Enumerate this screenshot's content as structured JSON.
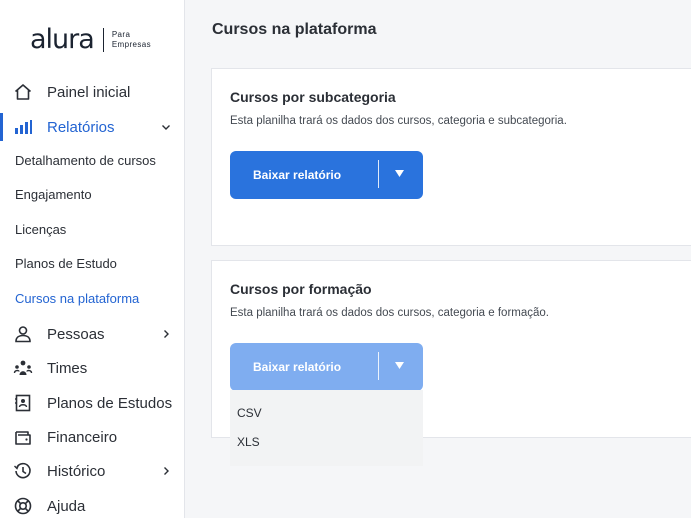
{
  "brand": {
    "name": "alura",
    "tagline_line1": "Para",
    "tagline_line2": "Empresas"
  },
  "sidebar": {
    "main_items": [
      {
        "label": "Painel inicial",
        "icon": "home-icon"
      },
      {
        "label": "Relatórios",
        "icon": "bar-chart-icon",
        "expanded": true,
        "active": true
      },
      {
        "label": "Pessoas",
        "icon": "person-icon",
        "has_submenu": true
      },
      {
        "label": "Times",
        "icon": "team-icon"
      },
      {
        "label": "Planos de Estudos",
        "icon": "study-plan-icon"
      },
      {
        "label": "Financeiro",
        "icon": "wallet-icon"
      },
      {
        "label": "Histórico",
        "icon": "history-icon",
        "has_submenu": true
      },
      {
        "label": "Ajuda",
        "icon": "help-icon"
      }
    ],
    "report_subitems": [
      {
        "label": "Detalhamento de cursos"
      },
      {
        "label": "Engajamento"
      },
      {
        "label": "Licenças"
      },
      {
        "label": "Planos de Estudo"
      },
      {
        "label": "Cursos na plataforma",
        "current": true
      }
    ]
  },
  "main": {
    "title": "Cursos na plataforma",
    "cards": [
      {
        "title": "Cursos por subcategoria",
        "description": "Esta planilha trará os dados dos cursos, categoria e subcategoria.",
        "button_label": "Baixar relatório",
        "button_state": "enabled"
      },
      {
        "title": "Cursos por formação",
        "description": "Esta planilha trará os dados dos cursos, categoria e formação.",
        "button_label": "Baixar relatório",
        "button_state": "disabled-open",
        "dropdown_options": [
          "CSV",
          "XLS"
        ]
      }
    ]
  },
  "colors": {
    "accent": "#2364d2",
    "button_primary": "#2a73dd",
    "button_disabled": "#7fadf0",
    "background": "#f5f6f8"
  }
}
